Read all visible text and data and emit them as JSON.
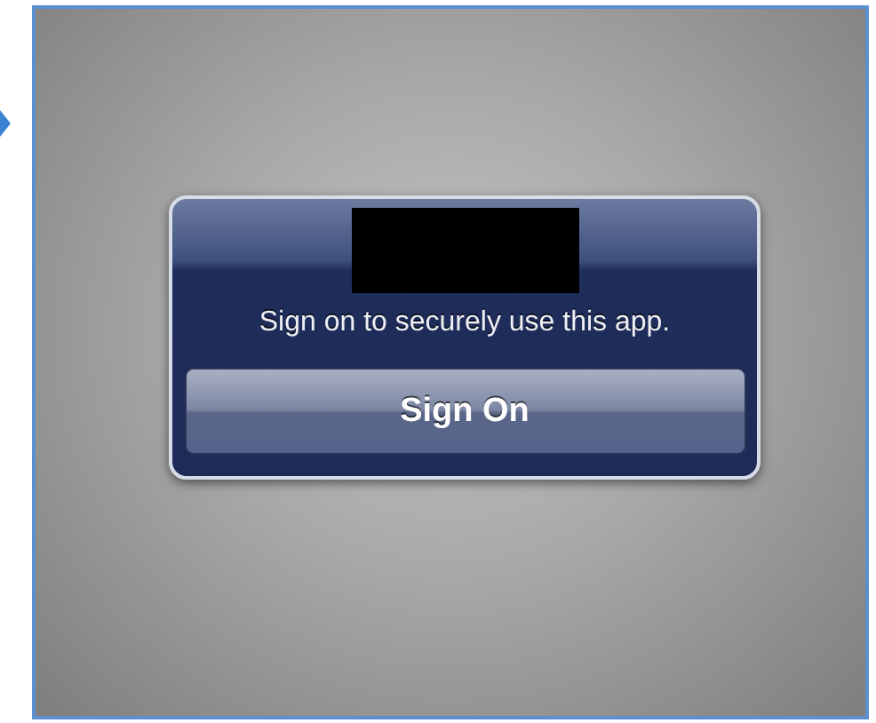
{
  "dialog": {
    "message": "Sign on to securely use this app.",
    "button": "Sign On"
  }
}
